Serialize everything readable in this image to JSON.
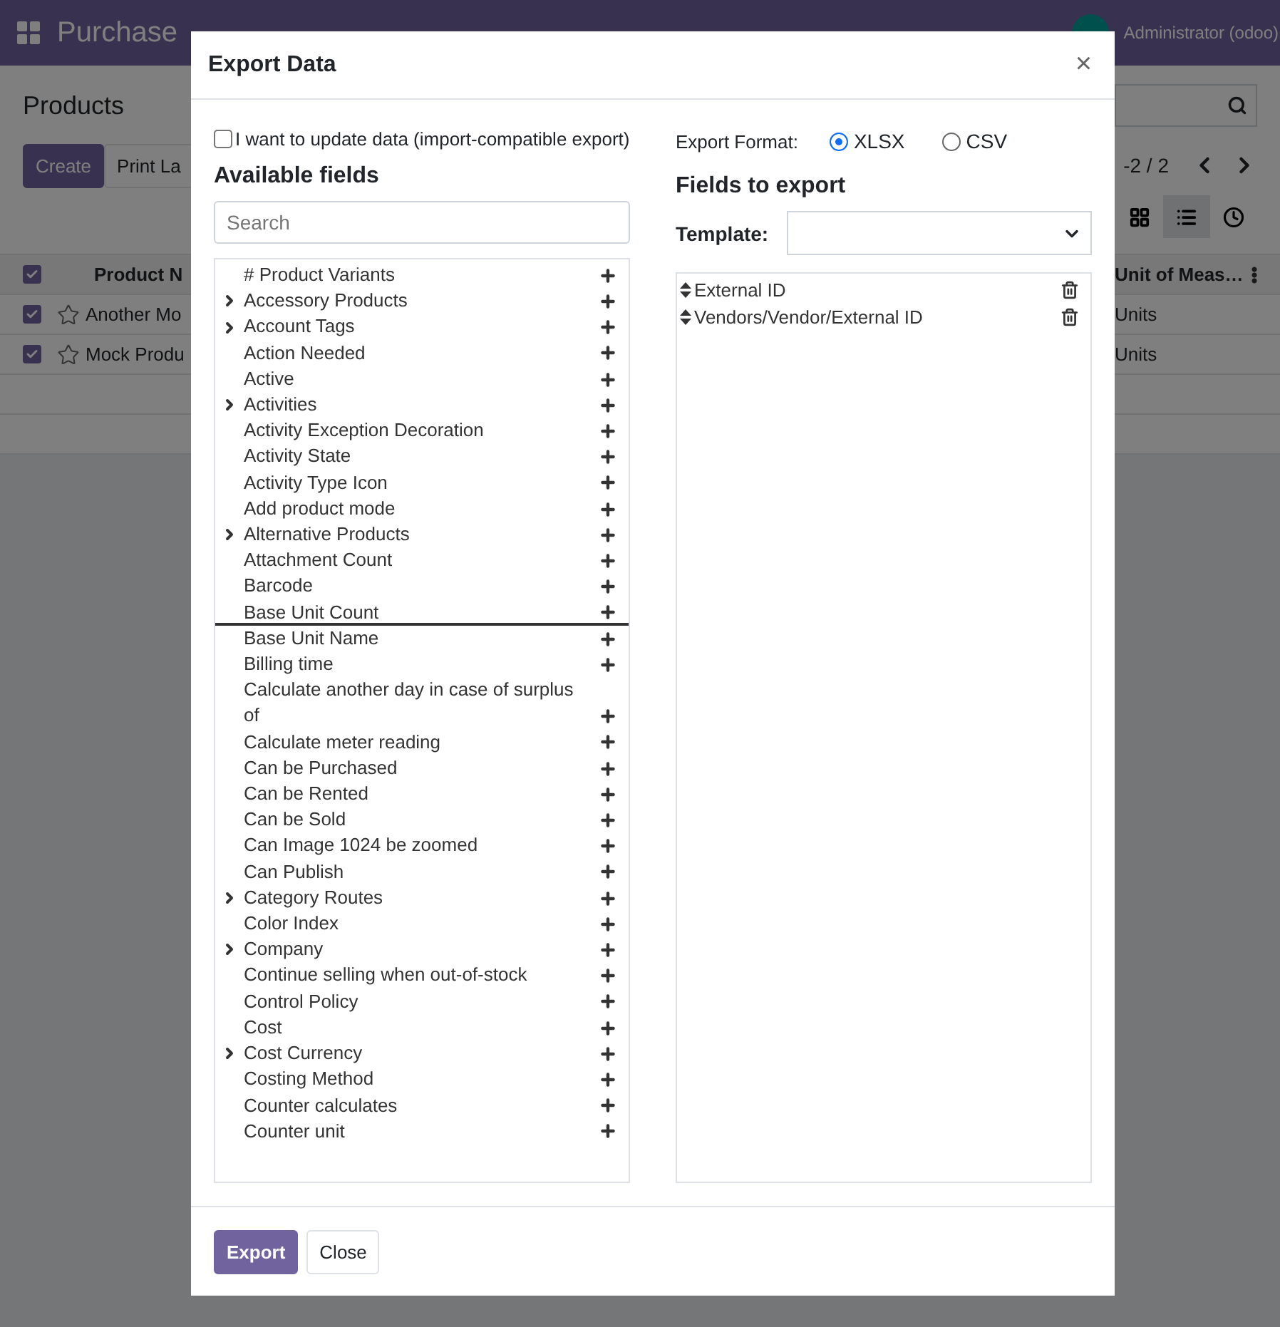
{
  "navbar": {
    "app_title": "Purchase",
    "user": "Administrator (odoo)"
  },
  "control_panel": {
    "title": "Products",
    "buttons": [
      {
        "label": "Create",
        "kind": "primary"
      },
      {
        "label": "Print La",
        "kind": "secondary"
      }
    ],
    "pager": "-2 / 2",
    "views": [
      {
        "kind": "kanban",
        "selected": false
      },
      {
        "kind": "list",
        "selected": true
      },
      {
        "kind": "activity",
        "selected": false
      }
    ]
  },
  "table": {
    "columns": [
      "Product N",
      "Unit of Meas…"
    ],
    "header_checked": true,
    "rows": [
      {
        "checked": true,
        "name": "Another Mo",
        "unit": "Units"
      },
      {
        "checked": true,
        "name": "Mock Produ",
        "unit": "Units"
      }
    ]
  },
  "dialog": {
    "title": "Export Data",
    "close": "×",
    "import_compat": {
      "label": "I want to update data (import-compatible export)",
      "checked": false
    },
    "format_label": "Export Format:",
    "formats": [
      {
        "label": "XLSX",
        "selected": true
      },
      {
        "label": "CSV",
        "selected": false
      }
    ],
    "available_title": "Available fields",
    "search": {
      "placeholder": "Search"
    },
    "available_fields": [
      {
        "label": "# Product Variants",
        "expandable": false,
        "selected": false
      },
      {
        "label": "Accessory Products",
        "expandable": true,
        "selected": false
      },
      {
        "label": "Account Tags",
        "expandable": true,
        "selected": false
      },
      {
        "label": "Action Needed",
        "expandable": false,
        "selected": false
      },
      {
        "label": "Active",
        "expandable": false,
        "selected": false
      },
      {
        "label": "Activities",
        "expandable": true,
        "selected": false
      },
      {
        "label": "Activity Exception Decoration",
        "expandable": false,
        "selected": false
      },
      {
        "label": "Activity State",
        "expandable": false,
        "selected": false
      },
      {
        "label": "Activity Type Icon",
        "expandable": false,
        "selected": false
      },
      {
        "label": "Add product mode",
        "expandable": false,
        "selected": false
      },
      {
        "label": "Alternative Products",
        "expandable": true,
        "selected": false
      },
      {
        "label": "Attachment Count",
        "expandable": false,
        "selected": false
      },
      {
        "label": "Barcode",
        "expandable": false,
        "selected": false
      },
      {
        "label": "Base Unit Count",
        "expandable": false,
        "selected": true
      },
      {
        "label": "Base Unit Name",
        "expandable": false,
        "selected": false
      },
      {
        "label": "Billing time",
        "expandable": false,
        "selected": false
      },
      {
        "label": "Calculate another day in case of surplus of",
        "expandable": false,
        "selected": false
      },
      {
        "label": "Calculate meter reading",
        "expandable": false,
        "selected": false
      },
      {
        "label": "Can be Purchased",
        "expandable": false,
        "selected": false
      },
      {
        "label": "Can be Rented",
        "expandable": false,
        "selected": false
      },
      {
        "label": "Can be Sold",
        "expandable": false,
        "selected": false
      },
      {
        "label": "Can Image 1024 be zoomed",
        "expandable": false,
        "selected": false
      },
      {
        "label": "Can Publish",
        "expandable": false,
        "selected": false
      },
      {
        "label": "Category Routes",
        "expandable": true,
        "selected": false
      },
      {
        "label": "Color Index",
        "expandable": false,
        "selected": false
      },
      {
        "label": "Company",
        "expandable": true,
        "selected": false
      },
      {
        "label": "Continue selling when out-of-stock",
        "expandable": false,
        "selected": false
      },
      {
        "label": "Control Policy",
        "expandable": false,
        "selected": false
      },
      {
        "label": "Cost",
        "expandable": false,
        "selected": false
      },
      {
        "label": "Cost Currency",
        "expandable": true,
        "selected": false
      },
      {
        "label": "Costing Method",
        "expandable": false,
        "selected": false
      },
      {
        "label": "Counter calculates",
        "expandable": false,
        "selected": false
      },
      {
        "label": "Counter unit",
        "expandable": false,
        "selected": false
      }
    ],
    "export_title": "Fields to export",
    "template_label": "Template:",
    "export_fields": [
      "External ID",
      "Vendors/Vendor/External ID"
    ],
    "buttons": [
      {
        "label": "Export",
        "kind": "primary"
      },
      {
        "label": "Close",
        "kind": "secondary"
      }
    ]
  }
}
